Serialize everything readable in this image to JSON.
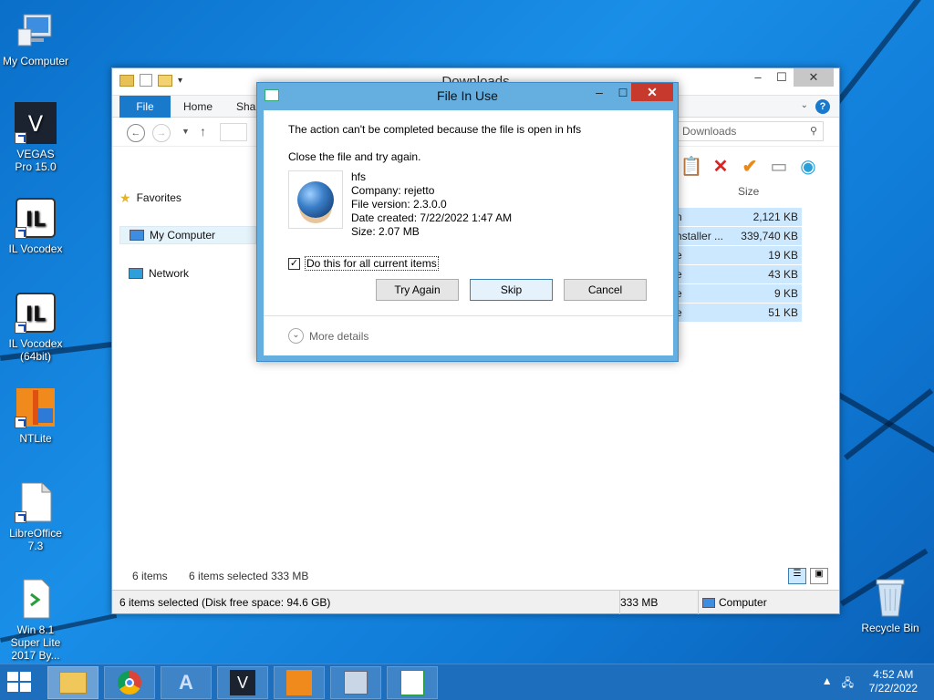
{
  "desktop": {
    "icons": [
      {
        "label": "My Computer"
      },
      {
        "label": "VEGAS Pro 15.0"
      },
      {
        "label": "IL Vocodex"
      },
      {
        "label": "IL Vocodex (64bit)"
      },
      {
        "label": "NTLite"
      },
      {
        "label": "LibreOffice 7.3"
      },
      {
        "label": "Win 8.1 Super Lite 2017 By..."
      },
      {
        "label": "Recycle Bin"
      }
    ]
  },
  "explorer": {
    "title": "Downloads",
    "tabs": {
      "file": "File",
      "home": "Home",
      "share": "Shar"
    },
    "search_placeholder": "Downloads",
    "nav": {
      "favorites": "Favorites",
      "my_computer": "My Computer",
      "network": "Network"
    },
    "columns": {
      "size": "Size"
    },
    "files": [
      {
        "name": "n",
        "size": "2,121 KB"
      },
      {
        "name": "nstaller ...",
        "size": "339,740 KB"
      },
      {
        "name": "e",
        "size": "19 KB"
      },
      {
        "name": "e",
        "size": "43 KB"
      },
      {
        "name": "e",
        "size": "9 KB"
      },
      {
        "name": "e",
        "size": "51 KB"
      }
    ],
    "status_items": "6 items",
    "status_selected": "6 items selected  333 MB",
    "statusbar": {
      "selection": "6 items selected (Disk free space: 94.6 GB)",
      "size": "333 MB",
      "location": "Computer"
    }
  },
  "dialog": {
    "title": "File In Use",
    "message": "The action can't be completed because the file is open in hfs",
    "instruction": "Close the file and try again.",
    "file": {
      "name": "hfs",
      "company": "Company: rejetto",
      "version": "File version: 2.3.0.0",
      "created": "Date created: 7/22/2022 1:47 AM",
      "size": "Size: 2.07 MB"
    },
    "checkbox_label": "Do this for all current items",
    "checkbox_checked": true,
    "buttons": {
      "try_again": "Try Again",
      "skip": "Skip",
      "cancel": "Cancel"
    },
    "more_details": "More details"
  },
  "taskbar": {
    "time": "4:52 AM",
    "date": "7/22/2022"
  },
  "colors": {
    "accent": "#1979ca",
    "dialog_frame": "#64aee0",
    "close_button": "#c7392c",
    "taskbar": "#1d6fbe"
  }
}
